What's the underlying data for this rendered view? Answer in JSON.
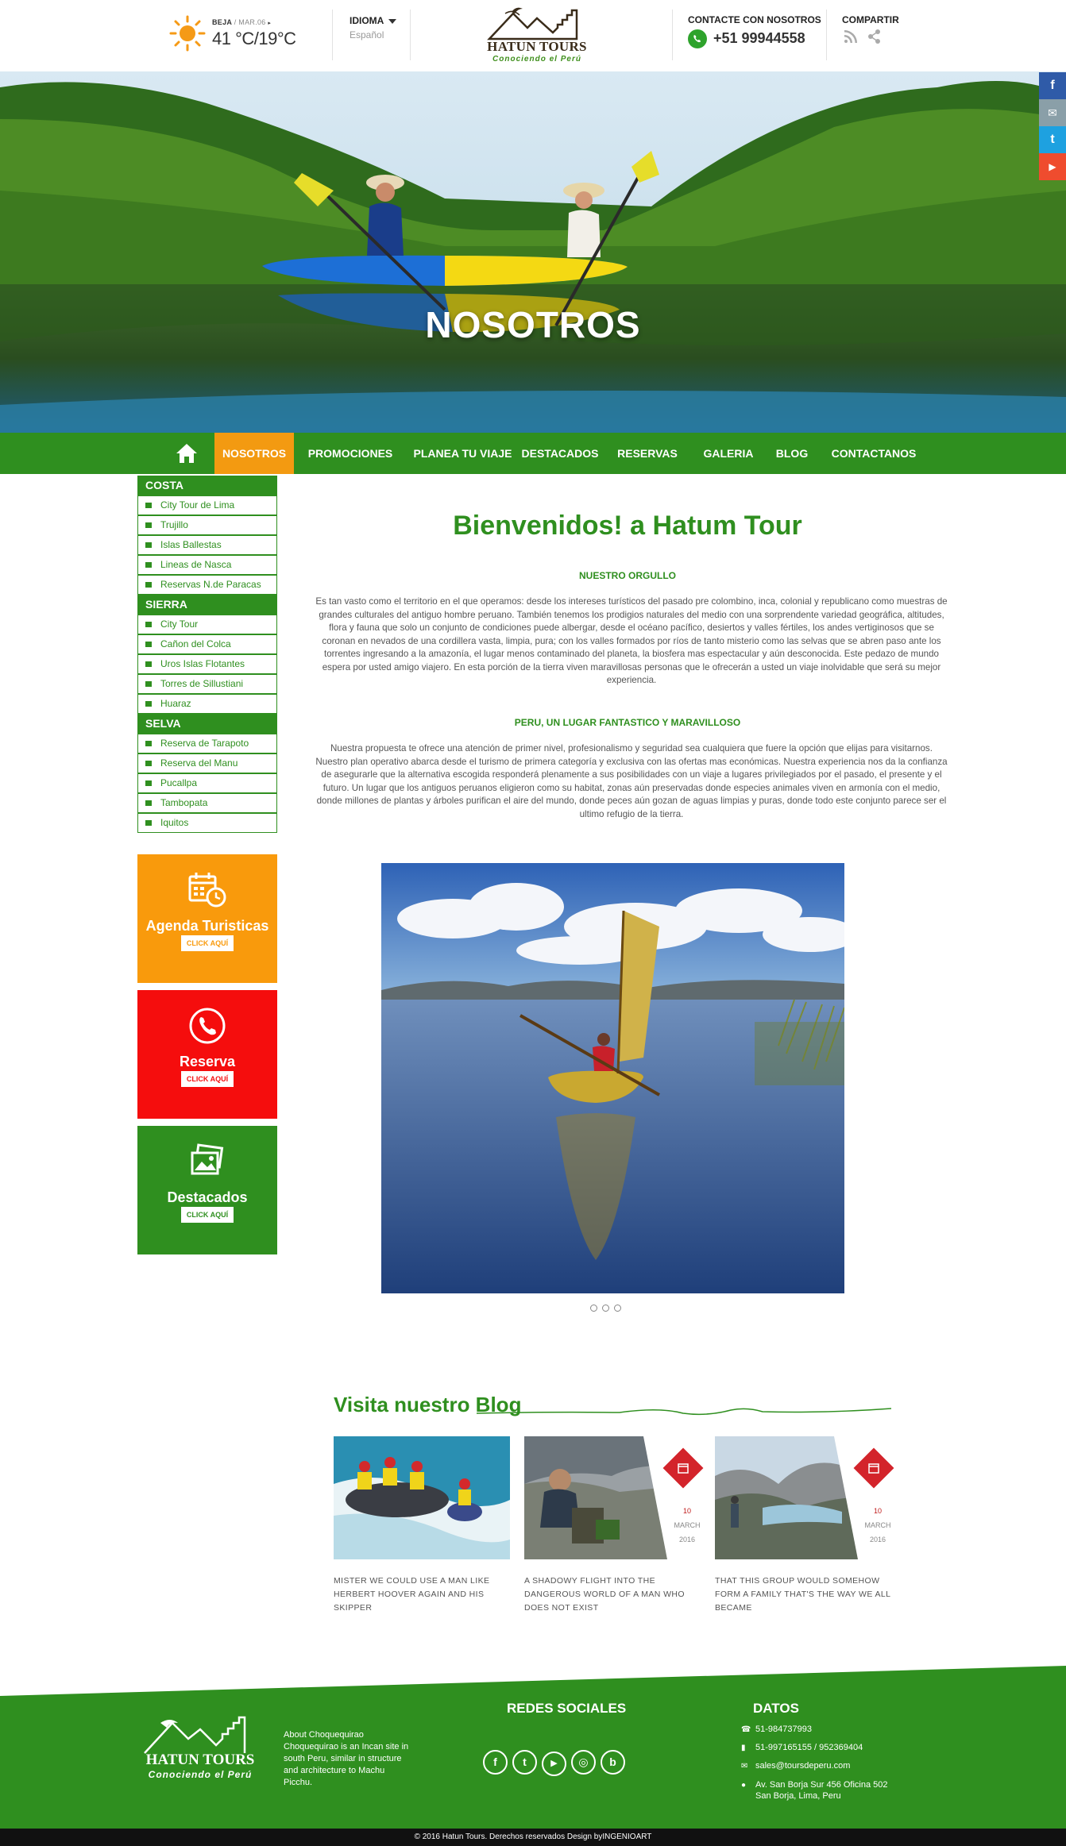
{
  "header": {
    "weather_location": "BEJA",
    "weather_day": "/ MAR.06",
    "weather_temp": "41 °C/19°C",
    "language_title": "IDIOMA",
    "language_value": "Español",
    "logo_title": "HATUN TOURS",
    "logo_subtitle": "Conociendo el Perú",
    "contact_title": "CONTACTE CON NOSOTROS",
    "contact_phone": "+51 99944558",
    "share_title": "COMPARTIR"
  },
  "side_social": [
    "f",
    "✉",
    "t",
    "▶"
  ],
  "hero": {
    "title": "NOSOTROS"
  },
  "nav": {
    "items": [
      "NOSOTROS",
      "PROMOCIONES",
      "PLANEA TU VIAJE",
      "DESTACADOS",
      "RESERVAS",
      "GALERIA",
      "BLOG",
      "CONTACTANOS"
    ],
    "active": "NOSOTROS"
  },
  "sidebar": {
    "costa": {
      "title": "COSTA",
      "items": [
        "City Tour de Lima",
        "Trujillo",
        "Islas Ballestas",
        "Lineas de Nasca",
        "Reservas N.de Paracas"
      ]
    },
    "sierra": {
      "title": "SIERRA",
      "items": [
        "City Tour",
        "Cañon del Colca",
        "Uros Islas Flotantes",
        "Torres de Sillustiani",
        "Huaraz"
      ]
    },
    "selva": {
      "title": "SELVA",
      "items": [
        "Reserva de Tarapoto",
        "Reserva del Manu",
        "Pucallpa",
        "Tambopata",
        "Iquitos"
      ]
    },
    "boxes": [
      {
        "title": "Agenda Turisticas",
        "button": "CLICK AQUÍ",
        "color": "#f99a0c"
      },
      {
        "title": "Reserva",
        "button": "CLICK AQUÍ",
        "color": "#f50d0d"
      },
      {
        "title": "Destacados",
        "button": "CLICK AQUÍ",
        "color": "#2f8f1f"
      }
    ]
  },
  "main": {
    "title": "Bienvenidos! a Hatum Tour",
    "section1_title": "NUESTRO ORGULLO",
    "section1_text": "Es tan vasto como el territorio en el que operamos: desde los intereses turísticos del pasado pre colombino, inca, colonial y republicano como muestras de grandes culturales del antiguo hombre peruano. También tenemos los prodigios naturales del medio con una sorprendente variedad geográfica, altitudes, flora y fauna que solo un conjunto de condiciones puede albergar, desde el océano pacífico, desiertos y valles fértiles, los andes vertiginosos que se coronan en nevados de una cordillera vasta, limpia, pura; con los valles formados por ríos de tanto misterio como las selvas que se abren paso ante los torrentes ingresando a la amazonía, el lugar menos contaminado del planeta, la biosfera mas espectacular y aún desconocida. Este pedazo de mundo espera por usted amigo viajero. En esta porción de la tierra viven maravillosas personas que le ofrecerán a usted un viaje inolvidable que será su mejor experiencia.",
    "section2_title": "PERU, UN LUGAR FANTASTICO Y MARAVILLOSO",
    "section2_text": "Nuestra propuesta te ofrece una atención de primer nivel, profesionalismo y seguridad sea cualquiera que fuere la opción que elijas para visitarnos. Nuestro plan operativo abarca desde el turismo de primera categoría y exclusiva con las ofertas mas económicas. Nuestra experiencia nos da la confianza de asegurarle que la alternativa escogida responderá plenamente a sus posibilidades con un viaje a lugares privilegiados por el pasado, el presente y el futuro. Un lugar que los antiguos peruanos eligieron como su habitat, zonas aún preservadas donde especies animales viven en armonía con el medio, donde millones de plantas y árboles purifican el aire del mundo, donde peces aún gozan de aguas limpias y puras, donde todo este conjunto parece ser el ultimo refugio de la tierra."
  },
  "blog": {
    "title": "Visita nuestro Blog",
    "posts": [
      {
        "caption": "MISTER WE COULD USE A MAN LIKE HERBERT HOOVER AGAIN AND HIS SKIPPER",
        "day": "",
        "month": "",
        "year": ""
      },
      {
        "caption": "A SHADOWY FLIGHT INTO THE DANGEROUS WORLD OF A MAN WHO DOES NOT EXIST",
        "day": "10",
        "month": "MARCH",
        "year": "2016"
      },
      {
        "caption": "THAT THIS GROUP WOULD SOMEHOW FORM A FAMILY THAT'S THE WAY WE ALL BECAME",
        "day": "10",
        "month": "MARCH",
        "year": "2016"
      }
    ]
  },
  "footer": {
    "logo_title": "HATUN TOURS",
    "logo_subtitle": "Conociendo el Perú",
    "about_title": "About Choquequirao",
    "about_text": "Choquequirao is an Incan site in south Peru, similar in structure and architecture to Machu Picchu.",
    "social_title": "REDES SOCIALES",
    "social_icons": [
      "f",
      "t",
      "▶",
      "◎",
      "b"
    ],
    "data_title": "DATOS",
    "phone1": "51-984737993",
    "phone2": "51-997165155 / 952369404",
    "email": "sales@toursdeperu.com",
    "address1": "Av. San Borja Sur 456 Oficina 502",
    "address2": "San Borja, Lima, Peru",
    "copyright": "© 2016  Hatun Tours. Derechos reservados Design byINGENIOART"
  },
  "colors": {
    "green": "#2f8f1f",
    "orange": "#f39a11",
    "red": "#f50d0d"
  }
}
